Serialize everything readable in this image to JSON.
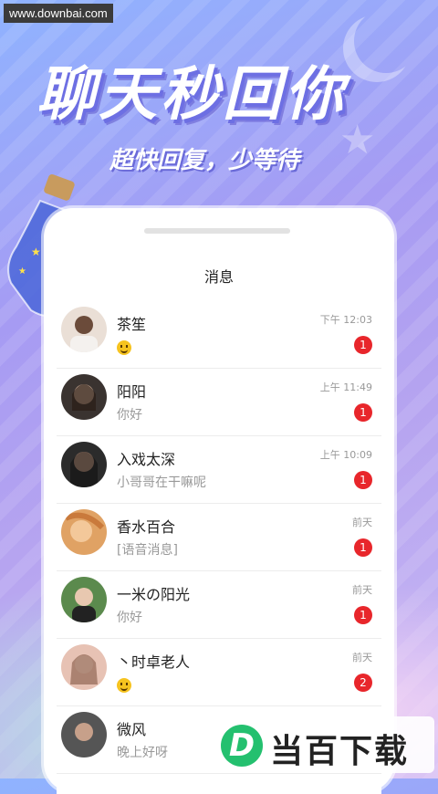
{
  "watermark": "www.downbai.com",
  "headline": "聊天秒回你",
  "subline": "超快回复，少等待",
  "screen_title": "消息",
  "conversations": [
    {
      "name": "茶笙",
      "message": "",
      "has_emoji": true,
      "time": "下午 12:03",
      "unread": "1"
    },
    {
      "name": "阳阳",
      "message": "你好",
      "has_emoji": false,
      "time": "上午 11:49",
      "unread": "1"
    },
    {
      "name": "入戏太深",
      "message": "小哥哥在干嘛呢",
      "has_emoji": false,
      "time": "上午 10:09",
      "unread": "1"
    },
    {
      "name": "香水百合",
      "message": "[语音消息]",
      "has_emoji": false,
      "time": "前天",
      "unread": "1"
    },
    {
      "name": "一米の阳光",
      "message": "你好",
      "has_emoji": false,
      "time": "前天",
      "unread": "1"
    },
    {
      "name": "丶时卓老人",
      "message": "",
      "has_emoji": true,
      "time": "前天",
      "unread": "2"
    },
    {
      "name": "微风",
      "message": "晚上好呀",
      "has_emoji": false,
      "time": "",
      "unread": ""
    }
  ],
  "logo": {
    "mark": "D",
    "text": "当百下载"
  },
  "colors": {
    "badge": "#e8262b",
    "accent": "#6d6fe3"
  }
}
